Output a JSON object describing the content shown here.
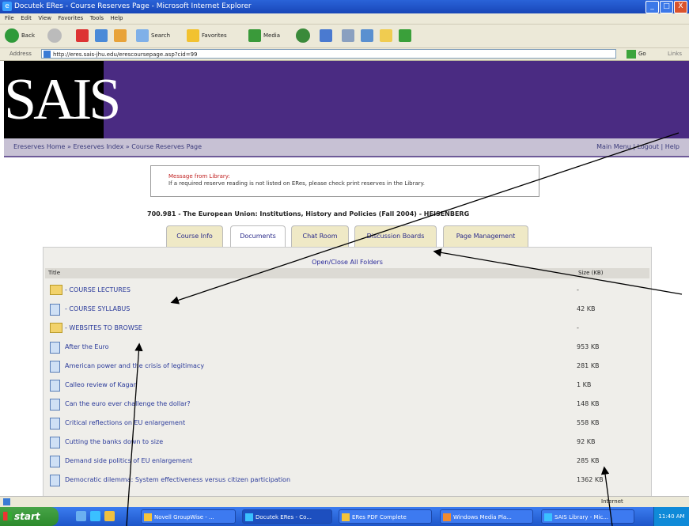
{
  "window": {
    "title": "Docutek ERes - Course Reserves Page - Microsoft Internet Explorer",
    "ie_icon": "ie-icon",
    "controls": {
      "minimize": "_",
      "maximize": "□",
      "close": "X"
    }
  },
  "menubar": [
    "File",
    "Edit",
    "View",
    "Favorites",
    "Tools",
    "Help"
  ],
  "toolbar": {
    "back": "Back",
    "search": "Search",
    "favorites": "Favorites",
    "media": "Media"
  },
  "address": {
    "label": "Address",
    "url": "http://eres.sais-jhu.edu/erescoursepage.asp?cid=99",
    "go": "Go",
    "links": "Links"
  },
  "banner": {
    "logo": "SAIS"
  },
  "nav": {
    "breadcrumb": "Ereserves Home » Ereserves Index » Course Reserves Page",
    "main_menu": "Main Menu",
    "separator": "|",
    "logout": "Logout",
    "help": "Help"
  },
  "message": {
    "heading": "Message from Library:",
    "body": "If a required reserve reading is not listed on ERes, please check print reserves in the Library."
  },
  "course": {
    "title": "700.981 - The European Union: Institutions, History and Policies (Fall 2004) - HEISENBERG"
  },
  "tabs": [
    {
      "label": "Course Info"
    },
    {
      "label": "Documents"
    },
    {
      "label": "Chat Room"
    },
    {
      "label": "Discussion Boards"
    },
    {
      "label": "Page Management"
    }
  ],
  "documents": {
    "open_close": "Open/Close All Folders",
    "col_title": "Title",
    "col_size": "Size (KB)",
    "rows": [
      {
        "title": "- COURSE LECTURES",
        "size": "-",
        "type": "folder"
      },
      {
        "title": "- COURSE SYLLABUS",
        "size": "42 KB",
        "type": "folder"
      },
      {
        "title": "- WEBSITES TO BROWSE",
        "size": "-",
        "type": "folder"
      },
      {
        "title": "After the Euro",
        "size": "953 KB",
        "type": "doc"
      },
      {
        "title": "American power and the crisis of legitimacy",
        "size": "281 KB",
        "type": "doc"
      },
      {
        "title": "Calleo review of Kagan",
        "size": "1 KB",
        "type": "doc"
      },
      {
        "title": "Can the euro ever challenge the dollar?",
        "size": "148 KB",
        "type": "doc"
      },
      {
        "title": "Critical reflections on EU enlargement",
        "size": "558 KB",
        "type": "doc"
      },
      {
        "title": "Cutting the banks down to size",
        "size": "92 KB",
        "type": "doc"
      },
      {
        "title": "Demand side politics of EU enlargement",
        "size": "285 KB",
        "type": "doc"
      },
      {
        "title": "Democratic dilemma: System effectiveness versus citizen participation",
        "size": "1362 KB",
        "type": "doc"
      }
    ]
  },
  "statusbar": {
    "zone": "Internet"
  },
  "taskbar": {
    "start": "start",
    "tasks": [
      "Novell GroupWise - ...",
      "Docutek ERes - Co...",
      "ERes PDF Complete",
      "Windows Media Pla...",
      "SAIS Library - Mic..."
    ],
    "clock": "11:40 AM"
  }
}
